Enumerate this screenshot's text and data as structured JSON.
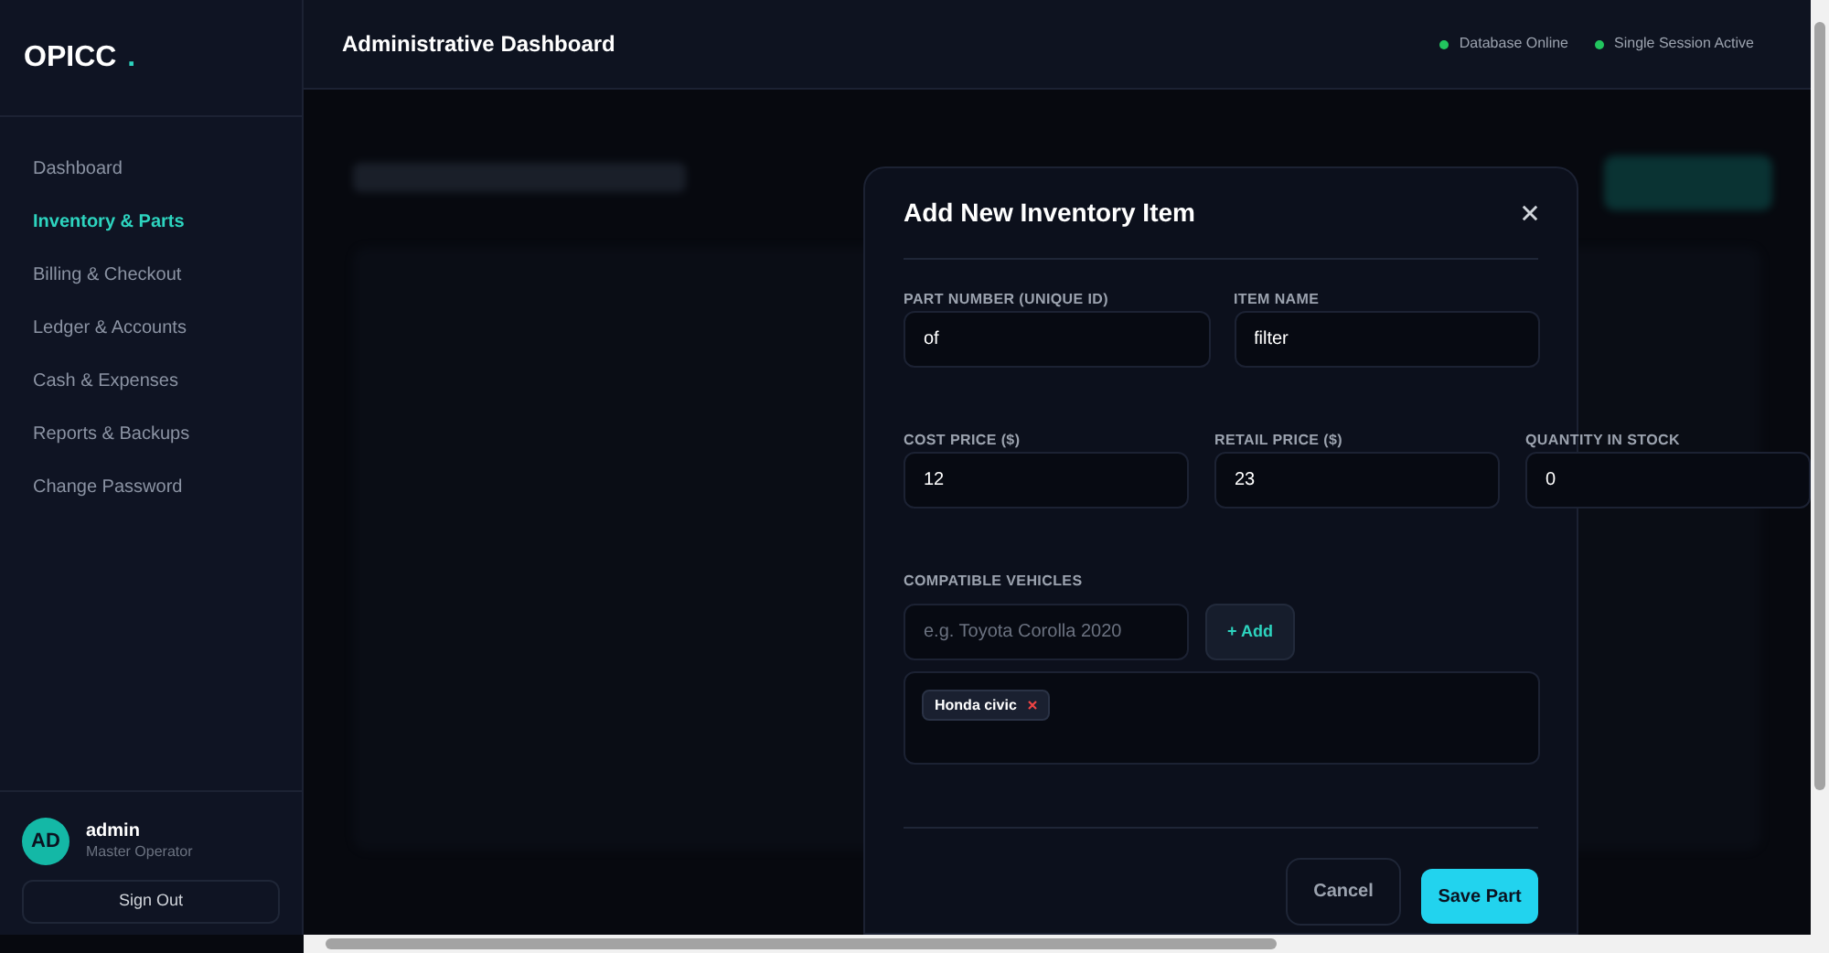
{
  "brand": {
    "name": "OPICC",
    "dot": "."
  },
  "nav": [
    {
      "label": "Dashboard",
      "selected": false
    },
    {
      "label": "Inventory & Parts",
      "selected": true
    },
    {
      "label": "Billing & Checkout",
      "selected": false
    },
    {
      "label": "Ledger & Accounts",
      "selected": false
    },
    {
      "label": "Cash & Expenses",
      "selected": false
    },
    {
      "label": "Reports & Backups",
      "selected": false
    },
    {
      "label": "Change Password",
      "selected": false
    }
  ],
  "user": {
    "initials": "AD",
    "name": "admin",
    "role": "Master Operator",
    "sign_out": "Sign Out"
  },
  "header": {
    "title": "Administrative Dashboard",
    "statuses": [
      {
        "label": "Database Online",
        "color": "#22c55e"
      },
      {
        "label": "Single Session Active",
        "color": "#22c55e"
      }
    ]
  },
  "modal": {
    "title": "Add New Inventory Item",
    "fields": [
      {
        "label": "PART NUMBER (UNIQUE ID)",
        "value": "of"
      },
      {
        "label": "ITEM NAME",
        "value": "filter"
      },
      {
        "label": "COST PRICE ($)",
        "value": "12"
      },
      {
        "label": "RETAIL PRICE ($)",
        "value": "23"
      },
      {
        "label": "QUANTITY IN STOCK",
        "value": "0"
      }
    ],
    "vehicles": {
      "label": "COMPATIBLE VEHICLES",
      "placeholder": "e.g. Toyota Corolla 2020",
      "add": "+ Add",
      "tags": [
        "Honda civic"
      ]
    },
    "cancel": "Cancel",
    "save": "Save Part"
  }
}
